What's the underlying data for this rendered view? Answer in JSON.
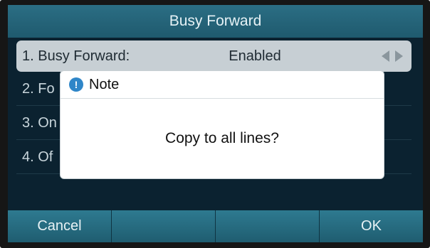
{
  "header": {
    "title": "Busy Forward"
  },
  "list": {
    "items": [
      {
        "label": "1. Busy Forward:",
        "value": "Enabled"
      },
      {
        "label": "2. Fo"
      },
      {
        "label": "3. On"
      },
      {
        "label": "4. Of"
      }
    ]
  },
  "dialog": {
    "icon": "info-icon",
    "icon_glyph": "!",
    "title": "Note",
    "message": "Copy to all lines?"
  },
  "softkeys": {
    "cancel": "Cancel",
    "key2": "",
    "key3": "",
    "ok": "OK"
  },
  "colors": {
    "title_bar": "#2b6e84",
    "softkey": "#2e7a90",
    "selected_row": "#c7cfd4",
    "info_icon": "#2f86c8"
  }
}
